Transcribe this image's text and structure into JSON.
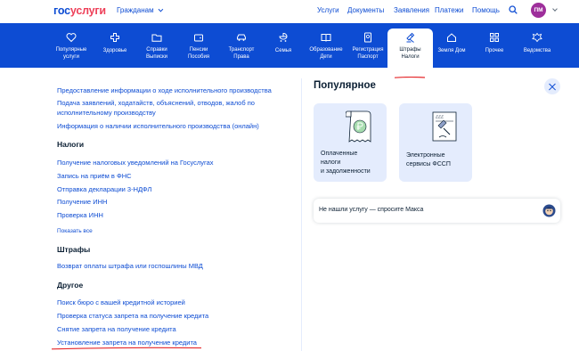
{
  "header": {
    "logo_part1": "гос",
    "logo_part2": "услуги",
    "audience": "Гражданам",
    "nav": [
      "Услуги",
      "Документы",
      "Заявления",
      "Платежи",
      "Помощь"
    ],
    "avatar_initials": "ПМ"
  },
  "categories": [
    {
      "line1": "Популярные",
      "line2": "услуги",
      "icon": "heart-icon"
    },
    {
      "line1": "Здоровье",
      "line2": "",
      "icon": "cross-icon"
    },
    {
      "line1": "Справки",
      "line2": "Выписки",
      "icon": "folder-icon"
    },
    {
      "line1": "Пенсии",
      "line2": "Пособия",
      "icon": "wallet-icon"
    },
    {
      "line1": "Транспорт",
      "line2": "Права",
      "icon": "car-icon"
    },
    {
      "line1": "Семья",
      "line2": "",
      "icon": "stroller-icon"
    },
    {
      "line1": "Образование",
      "line2": "Дети",
      "icon": "book-icon"
    },
    {
      "line1": "Регистрация",
      "line2": "Паспорт",
      "icon": "passport-icon"
    },
    {
      "line1": "Штрафы",
      "line2": "Налоги",
      "icon": "gavel-icon"
    },
    {
      "line1": "Земля Дом",
      "line2": "",
      "icon": "house-icon"
    },
    {
      "line1": "Прочее",
      "line2": "",
      "icon": "grid-icon"
    },
    {
      "line1": "Ведомства",
      "line2": "",
      "icon": "emblem-icon"
    }
  ],
  "left": {
    "top_links": [
      "Предоставление информации о ходе исполнительного производства",
      "Подача заявлений, ходатайств, объяснений, отводов, жалоб по",
      "исполнительному производству",
      "Информация о наличии исполнительного производства (онлайн)"
    ],
    "taxes_title": "Налоги",
    "taxes_links": [
      "Получение налоговых уведомлений на Госуслугах",
      "Запись на приём в ФНС",
      "Отправка декларации 3-НДФЛ",
      "Получение ИНН",
      "Проверка ИНН"
    ],
    "show_all": "Показать все",
    "fines_title": "Штрафы",
    "fines_links": [
      "Возврат оплаты штрафа или госпошлины МВД"
    ],
    "other_title": "Другое",
    "other_links": [
      "Поиск бюро с вашей кредитной историей",
      "Проверка статуса запрета на получение кредита",
      "Снятие запрета на получение кредита",
      "Установление запрета на получение кредита"
    ]
  },
  "right": {
    "title": "Популярное",
    "cards": [
      {
        "line1": "Оплаченные",
        "line2": "налоги",
        "line3": "и задолженности",
        "icon": "receipt-ruble-icon"
      },
      {
        "line1": "Электронные",
        "line2": "сервисы ФССП",
        "line3": "",
        "icon": "document-gavel-icon"
      }
    ],
    "maks_text": "Не нашли услугу — спросите Макса"
  },
  "colors": {
    "brand_blue": "#0d4cd3",
    "brand_red": "#ee3f58",
    "card_bg": "#e4ecfd",
    "annotation_red": "#e5282b"
  }
}
